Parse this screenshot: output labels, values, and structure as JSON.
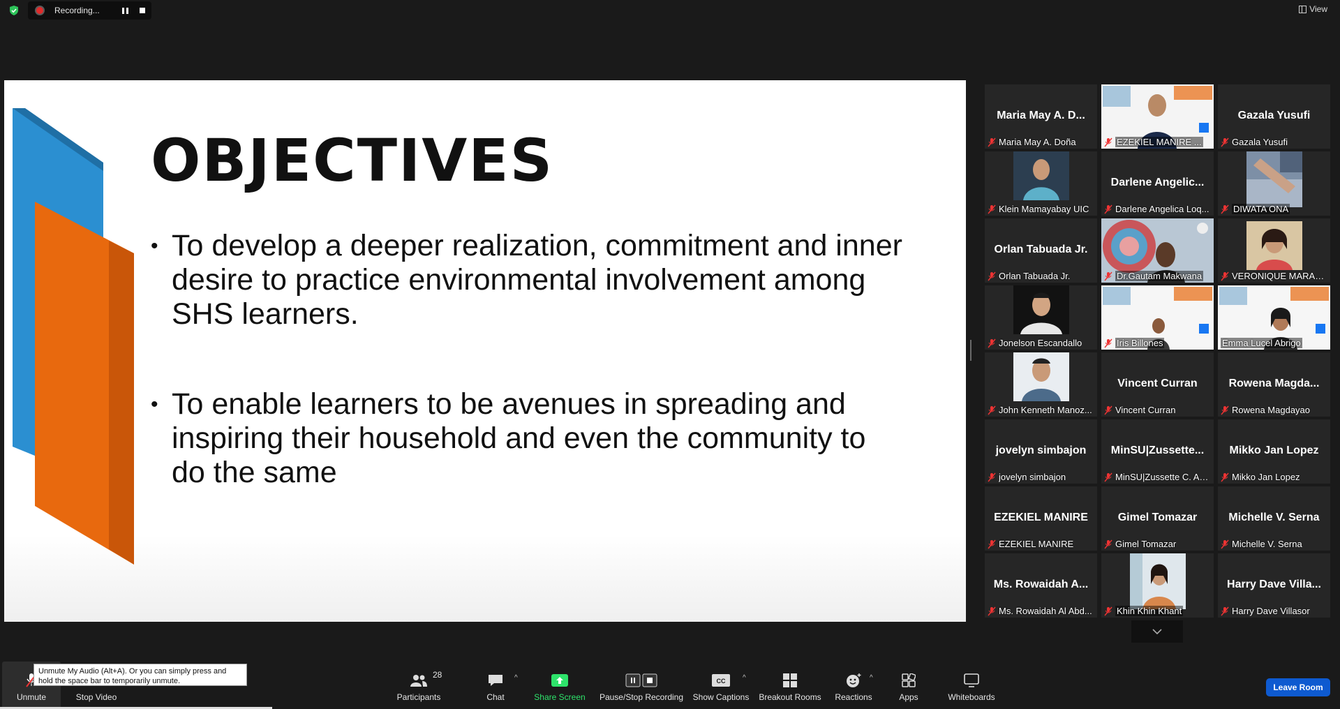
{
  "recording": {
    "label": "Recording..."
  },
  "view_label": "View",
  "slide": {
    "title": "OBJECTIVES",
    "bullets": [
      "To develop a deeper realization, commitment and inner desire to practice environmental involvement among SHS learners.",
      "To enable learners to be avenues in spreading and inspiring their household and even the community to do the same"
    ]
  },
  "gallery": [
    {
      "name": "Maria May A. D...",
      "label": "Maria May A. Doña",
      "video": false
    },
    {
      "name": "",
      "label": "EZEKIEL MANIRE ...",
      "video": true
    },
    {
      "name": "Gazala Yusufi",
      "label": "Gazala Yusufi",
      "video": false
    },
    {
      "name": "",
      "label": "Klein Mamayabay UIC",
      "video": true
    },
    {
      "name": "Darlene Angelic...",
      "label": "Darlene Angelica Loq...",
      "video": false
    },
    {
      "name": "",
      "label": "DIWATA ONA",
      "video": true
    },
    {
      "name": "Orlan Tabuada Jr.",
      "label": "Orlan Tabuada Jr.",
      "video": false
    },
    {
      "name": "",
      "label": "Dr.Gautam Makwana",
      "video": true
    },
    {
      "name": "",
      "label": "VERONIQUE MARAN...",
      "video": true
    },
    {
      "name": "",
      "label": "Jonelson Escandallo",
      "video": true
    },
    {
      "name": "",
      "label": "Iris Billones",
      "video": true
    },
    {
      "name": "",
      "label": "Emma Lucel Abrigo",
      "video": true
    },
    {
      "name": "",
      "label": "John Kenneth Manoz...",
      "video": true
    },
    {
      "name": "Vincent Curran",
      "label": "Vincent Curran",
      "video": false
    },
    {
      "name": "Rowena Magda...",
      "label": "Rowena Magdayao",
      "video": false
    },
    {
      "name": "jovelyn simbajon",
      "label": "jovelyn simbajon",
      "video": false
    },
    {
      "name": "MinSU|Zussette...",
      "label": "MinSU|Zussette C. Ap...",
      "video": false
    },
    {
      "name": "Mikko Jan Lopez",
      "label": "Mikko Jan Lopez",
      "video": false
    },
    {
      "name": "EZEKIEL MANIRE",
      "label": "EZEKIEL MANIRE",
      "video": false
    },
    {
      "name": "Gimel Tomazar",
      "label": "Gimel Tomazar",
      "video": false
    },
    {
      "name": "Michelle V. Serna",
      "label": "Michelle V. Serna",
      "video": false
    },
    {
      "name": "Ms. Rowaidah A...",
      "label": "Ms. Rowaidah Al Abd...",
      "video": false
    },
    {
      "name": "",
      "label": "Khin Khin Khant",
      "video": true
    },
    {
      "name": "Harry Dave Villa...",
      "label": "Harry Dave Villasor",
      "video": false
    }
  ],
  "toolbar": {
    "unmute": "Unmute",
    "unmute_tooltip": "Unmute My Audio (Alt+A). Or you can simply press and hold the space bar to temporarily unmute.",
    "stop_video": "Stop Video",
    "participants": "Participants",
    "participants_count": "28",
    "chat": "Chat",
    "share_screen": "Share Screen",
    "pause_stop_recording": "Pause/Stop Recording",
    "show_captions": "Show Captions",
    "breakout_rooms": "Breakout Rooms",
    "reactions": "Reactions",
    "apps": "Apps",
    "whiteboards": "Whiteboards",
    "leave_room": "Leave Room"
  },
  "colors": {
    "accent_green": "#2ee36b",
    "leave_blue": "#0e5ad0",
    "active_speaker": "#c7f24a",
    "recording_red": "#e02b2b"
  }
}
